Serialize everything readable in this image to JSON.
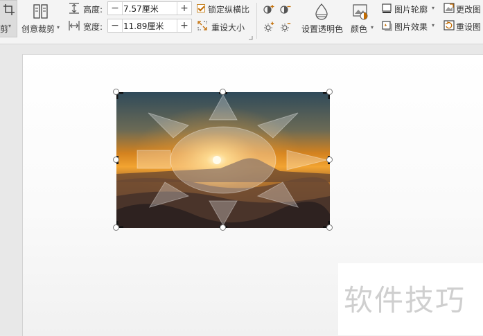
{
  "toolbar": {
    "crop_partial_label": "剪",
    "creative_crop_label": "创意裁剪",
    "height_label": "高度:",
    "height_value": "7.57厘米",
    "width_label": "宽度:",
    "width_value": "11.89厘米",
    "minus_symbol": "−",
    "plus_symbol": "+",
    "lock_ratio_label": "锁定纵横比",
    "lock_ratio_checked": true,
    "reset_size_label": "重设大小",
    "set_transparent_label": "设置透明色",
    "color_label": "颜色",
    "picture_outline_label": "图片轮廓",
    "picture_effects_label": "图片效果",
    "change_picture_label": "更改图",
    "reset_picture_label": "重设图",
    "accent_color": "#c98a2e"
  },
  "watermark": {
    "text": "软件技巧"
  }
}
